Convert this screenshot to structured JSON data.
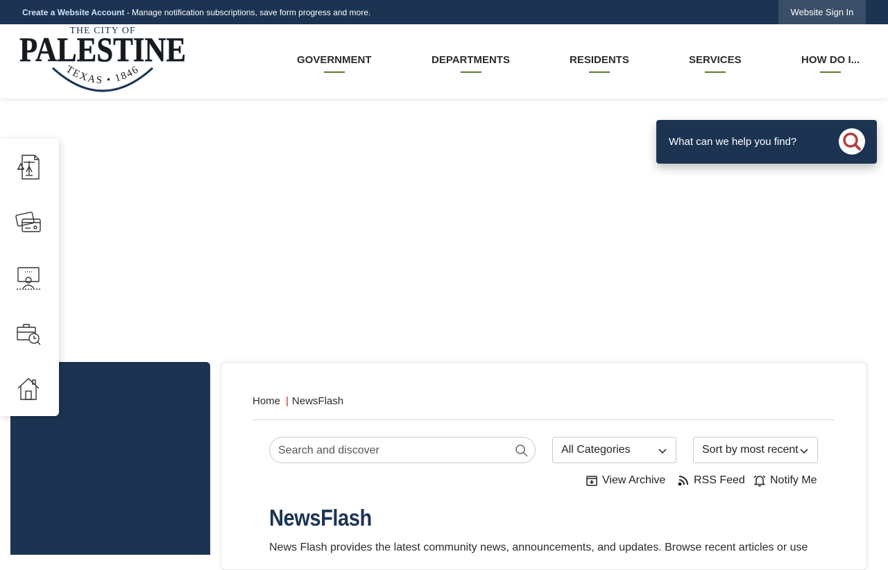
{
  "topbar": {
    "create_account": "Create a Website Account",
    "tagline": " - Manage notification subscriptions, save form progress and more.",
    "signin": "Website Sign In"
  },
  "logo": {
    "line1": "THE CITY OF",
    "name": "PALESTINE",
    "line3": "TEXAS • 1846"
  },
  "nav": [
    {
      "label": "GOVERNMENT"
    },
    {
      "label": "DEPARTMENTS"
    },
    {
      "label": "RESIDENTS"
    },
    {
      "label": "SERVICES"
    },
    {
      "label": "HOW DO I..."
    }
  ],
  "site_search": {
    "placeholder": "What can we help you find?",
    "icon": "search-icon"
  },
  "quicklinks": [
    {
      "icon": "legal-document-icon"
    },
    {
      "icon": "payment-card-icon"
    },
    {
      "icon": "meeting-presenter-icon"
    },
    {
      "icon": "jobs-briefcase-icon"
    },
    {
      "icon": "home-icon"
    }
  ],
  "breadcrumb": {
    "home": "Home",
    "separator": "|",
    "current": "NewsFlash"
  },
  "filters": {
    "search_placeholder": "Search and discover",
    "category": "All Categories",
    "sort": "Sort by most recent"
  },
  "actions": {
    "archive": "View Archive",
    "rss": "RSS Feed",
    "notify": "Notify Me"
  },
  "page": {
    "title": "NewsFlash",
    "intro": "News Flash provides the latest community news, announcements, and updates. Browse recent articles or use"
  },
  "colors": {
    "navy": "#1c3452",
    "accent_green": "#5a7a2e",
    "search_red": "#b0413e"
  }
}
